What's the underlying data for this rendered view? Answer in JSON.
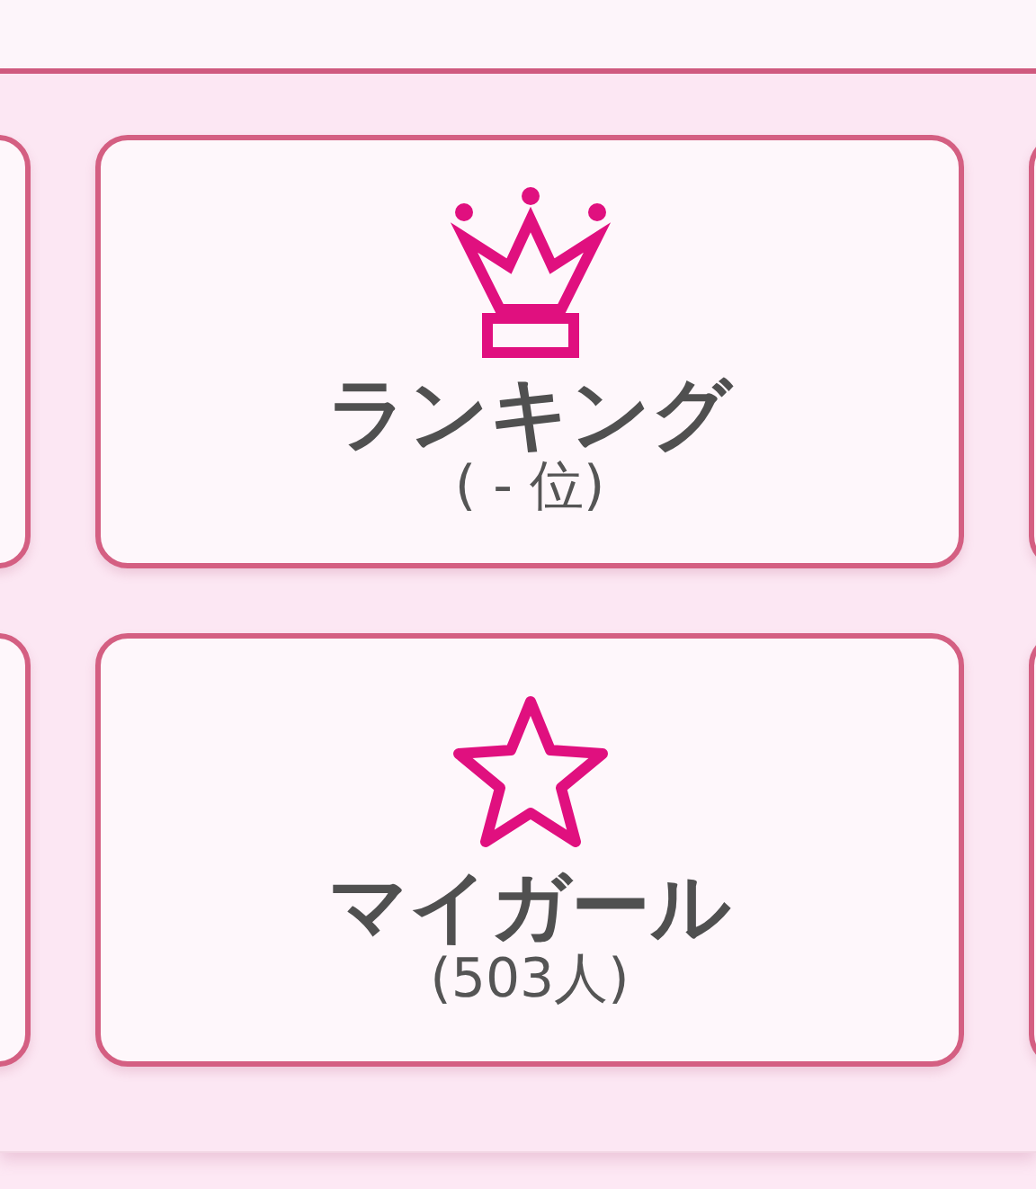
{
  "menu_rows": [
    {
      "items": [
        {
          "kind": "crown",
          "label": "ランキング",
          "detail": "( - 位)"
        }
      ]
    },
    {
      "items": [
        {
          "kind": "star",
          "label": "マイガール",
          "detail": "(503人)"
        }
      ]
    }
  ]
}
